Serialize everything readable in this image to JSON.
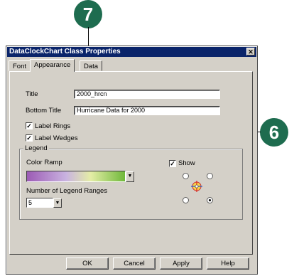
{
  "callouts": {
    "step7": "7",
    "step6": "6"
  },
  "dialog": {
    "title": "DataClockChart Class Properties",
    "close_glyph": "✕"
  },
  "tabs": [
    {
      "label": "Font"
    },
    {
      "label": "Appearance"
    },
    {
      "label": "Data"
    }
  ],
  "appearance": {
    "title_label": "Title",
    "title_value": "2000_hrcn",
    "bottom_title_label": "Bottom Title",
    "bottom_title_value": "Hurricane Data for 2000",
    "label_rings": {
      "label": "Label Rings",
      "checked": true
    },
    "label_wedges": {
      "label": "Label Wedges",
      "checked": true
    }
  },
  "legend": {
    "group_label": "Legend",
    "show_label": "Show",
    "show_checked": true,
    "color_ramp_label": "Color Ramp",
    "ranges_label": "Number of Legend Ranges",
    "ranges_value": "5",
    "position_selected": "bottom-right"
  },
  "buttons": {
    "ok": "OK",
    "cancel": "Cancel",
    "apply": "Apply",
    "help": "Help"
  },
  "glyphs": {
    "check": "✓",
    "dropdown": "▼"
  },
  "colors": {
    "titlebar": "#0a246a",
    "callout": "#1e6c4f",
    "dialog_bg": "#d4d0c8"
  }
}
